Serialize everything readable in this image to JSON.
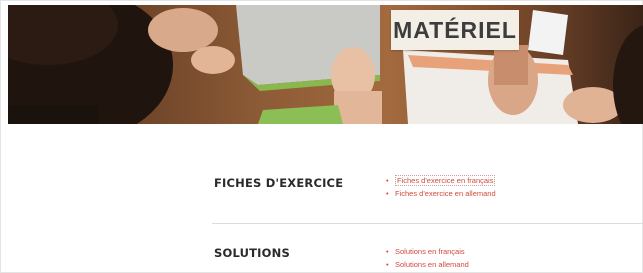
{
  "hero": {
    "title": "MATÉRIEL"
  },
  "sections": [
    {
      "title": "FICHES D'EXERCICE",
      "links": [
        "Fiches d'exercice en français",
        "Fiches d'exercice en allemand"
      ]
    },
    {
      "title": "SOLUTIONS",
      "links": [
        "Solutions en français",
        "Solutions en allemand"
      ]
    }
  ],
  "colors": {
    "link": "#d04a3c",
    "heading": "#2a2a2a",
    "title_badge_bg": "#f4efe6"
  }
}
